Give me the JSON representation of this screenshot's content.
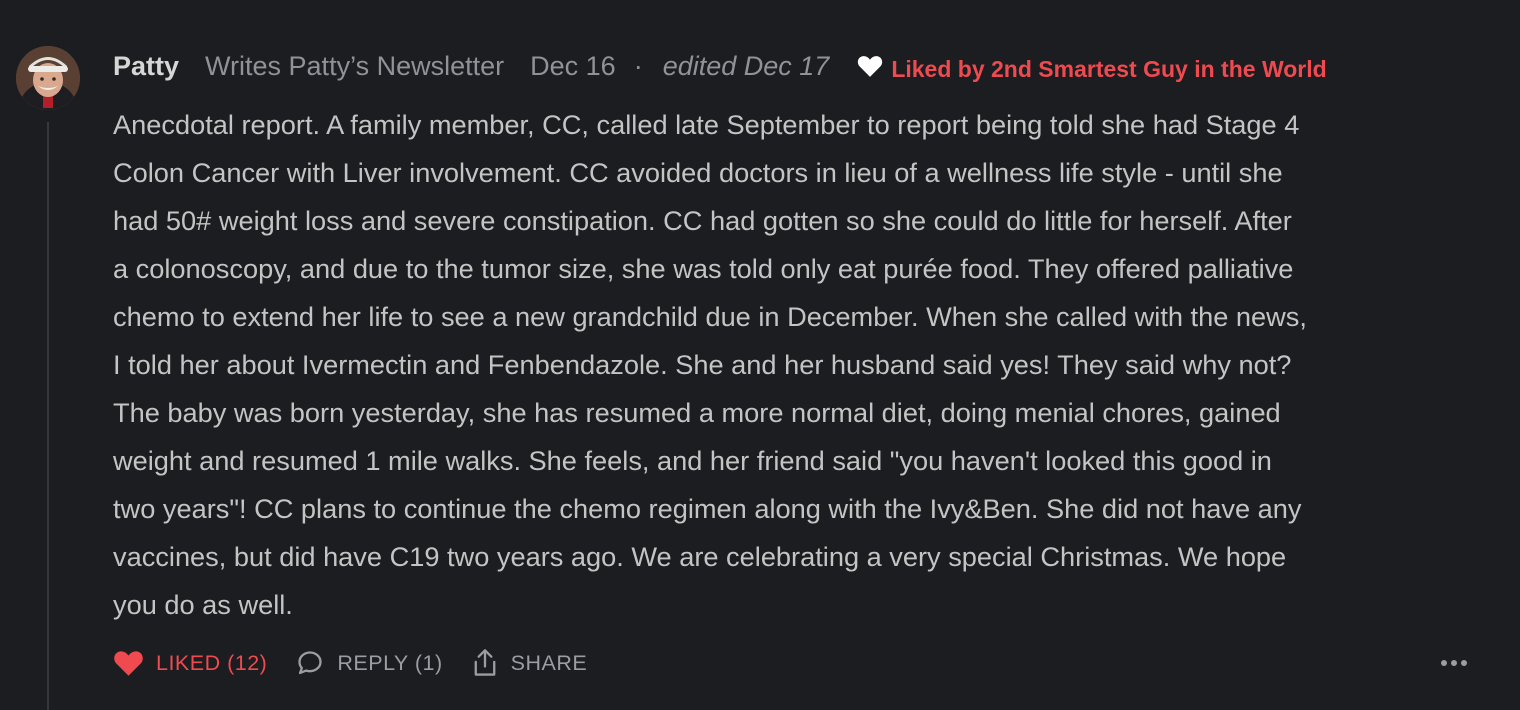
{
  "comment": {
    "author": "Patty",
    "publication": "Writes Patty’s Newsletter",
    "date": "Dec 16",
    "separator": "·",
    "edited": "edited Dec 17",
    "liked_by": "Liked by 2nd Smartest Guy in the World",
    "body_lines": [
      "Anecdotal report. A family member, CC, called late September to report being told she had Stage 4",
      "Colon Cancer with Liver involvement. CC avoided doctors in lieu of a wellness life style - until she",
      "had 50# weight loss and severe constipation. CC had gotten so she could do little for herself. After",
      "a colonoscopy, and due to the tumor size, she was told only eat purée food. They offered palliative",
      "chemo to extend her life to see a new grandchild due in December. When she called with the news,",
      "I told her about Ivermectin and Fenbendazole. She and her husband said yes! They said why not?",
      "The baby was born yesterday, she has resumed a more normal diet, doing menial chores, gained",
      "weight and resumed 1 mile walks. She feels, and her friend said \"you haven't looked this good in",
      "two years\"! CC plans to continue the chemo regimen along with the Ivy&Ben. She did not have any",
      "vaccines, but did have C19 two years ago. We are celebrating a very special Christmas. We hope",
      "you do as well."
    ],
    "actions": {
      "like_label": "LIKED (12)",
      "reply_label": "REPLY (1)",
      "share_label": "SHARE"
    }
  },
  "colors": {
    "background": "#1b1d20",
    "accent_red": "#ef4a4f",
    "muted_text": "#8f9296"
  }
}
